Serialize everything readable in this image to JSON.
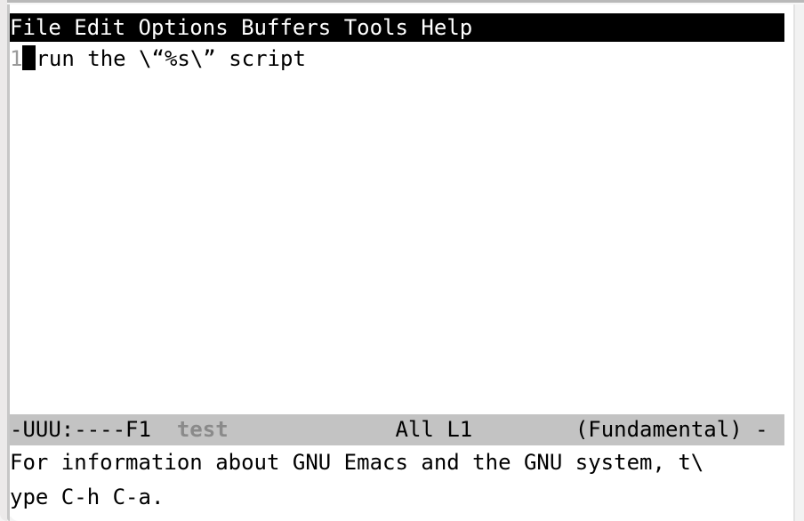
{
  "window": {
    "application": "GNU Emacs",
    "frame_background": "#ffffff",
    "border_color": "#c7c7c7"
  },
  "menu_bar": {
    "background": "#000000",
    "foreground": "#ffffff",
    "items": [
      {
        "label": "File"
      },
      {
        "label": "Edit"
      },
      {
        "label": "Options"
      },
      {
        "label": "Buffers"
      },
      {
        "label": "Tools"
      },
      {
        "label": "Help"
      }
    ],
    "text": "File Edit Options Buffers Tools Help"
  },
  "buffer": {
    "name": "test",
    "background": "#ffffff",
    "foreground": "#000000",
    "line_number_color": "#9a9a9a",
    "cursor_color": "#000000",
    "lines": [
      {
        "number": "1",
        "content": "run the \\“%s\\” script",
        "cursor_at_column": 0
      }
    ]
  },
  "mode_line": {
    "background": "#c3c3c3",
    "foreground": "#000000",
    "buffer_name_color": "#8a8a8a",
    "left_flags": "-UUU:----F1",
    "gap_1": "  ",
    "buffer_name": "test",
    "gap_2": "             ",
    "position_percent": "All",
    "line_indicator": "L1",
    "gap_3": "        ",
    "major_mode": "(Fundamental)",
    "trailing": " -",
    "full_text": "-UUU:----F1  test             All L1        (Fundamental) -"
  },
  "echo_area": {
    "background": "#ffffff",
    "foreground": "#000000",
    "lines": [
      "For information about GNU Emacs and the GNU system, t\\",
      "ype C-h C-a."
    ],
    "message": "For information about GNU Emacs and the GNU system, type C-h C-a."
  }
}
